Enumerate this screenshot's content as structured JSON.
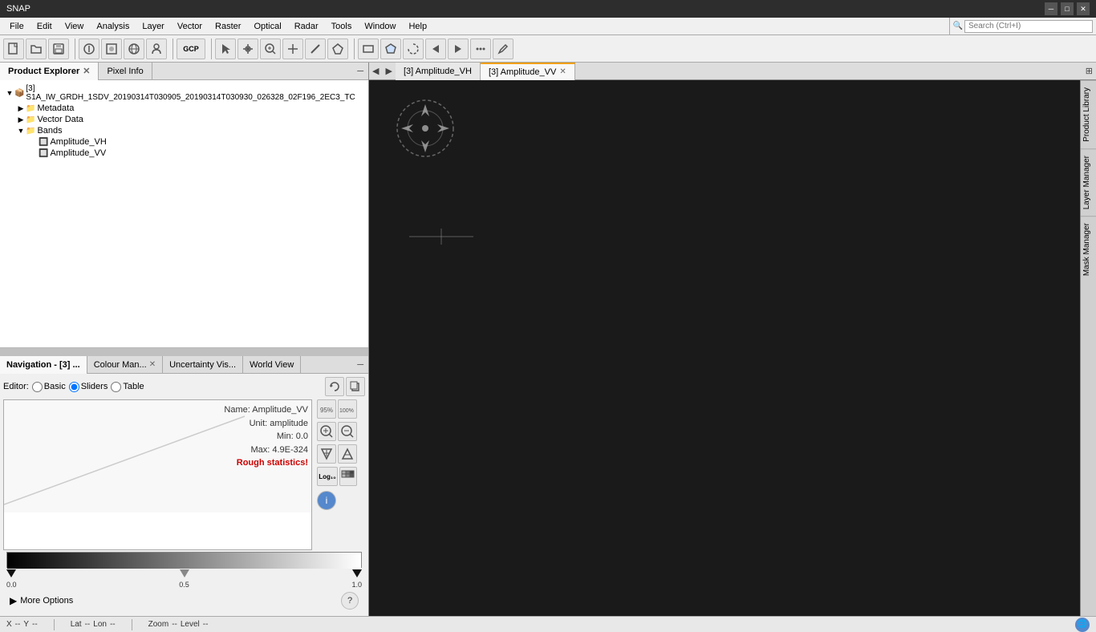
{
  "app": {
    "title": "SNAP",
    "window_controls": [
      "minimize",
      "maximize",
      "close"
    ]
  },
  "menubar": {
    "items": [
      "File",
      "Edit",
      "View",
      "Analysis",
      "Layer",
      "Vector",
      "Raster",
      "Optical",
      "Radar",
      "Tools",
      "Window",
      "Help"
    ]
  },
  "search": {
    "placeholder": "Search (Ctrl+I)",
    "value": ""
  },
  "toolbar": {
    "buttons": [
      {
        "name": "new",
        "icon": "⬜"
      },
      {
        "name": "open",
        "icon": "📁"
      },
      {
        "name": "save",
        "icon": "💾"
      },
      {
        "name": "print",
        "icon": "🖨"
      },
      {
        "name": "copy",
        "icon": "📋"
      },
      {
        "name": "paste",
        "icon": "📄"
      },
      {
        "name": "gcp",
        "icon": "GCP",
        "label": "GCP"
      },
      {
        "name": "select",
        "icon": "↖"
      },
      {
        "name": "pan",
        "icon": "✋"
      },
      {
        "name": "zoom",
        "icon": "🔍"
      },
      {
        "name": "pin",
        "icon": "+"
      },
      {
        "name": "draw-line",
        "icon": "╱"
      },
      {
        "name": "draw-poly",
        "icon": "⬟"
      },
      {
        "name": "draw-rect",
        "icon": "⬜"
      },
      {
        "name": "draw-ellipse",
        "icon": "⭕"
      },
      {
        "name": "warp",
        "icon": "↺"
      },
      {
        "name": "export",
        "icon": "➡"
      },
      {
        "name": "tool2",
        "icon": "↔"
      },
      {
        "name": "pencil",
        "icon": "✏"
      }
    ]
  },
  "left_panel": {
    "tabs": [
      {
        "label": "Product Explorer",
        "active": true,
        "closeable": true
      },
      {
        "label": "Pixel Info",
        "active": false,
        "closeable": false
      }
    ],
    "tree": {
      "root": {
        "label": "[3] S1A_IW_GRDH_1SDV_20190314T030905_20190314T030930_026328_02F196_2EC3_TC",
        "expanded": true,
        "children": [
          {
            "label": "Metadata",
            "icon": "folder",
            "expanded": false
          },
          {
            "label": "Vector Data",
            "icon": "folder",
            "expanded": false
          },
          {
            "label": "Bands",
            "icon": "folder",
            "expanded": true,
            "children": [
              {
                "label": "Amplitude_VH",
                "icon": "band"
              },
              {
                "label": "Amplitude_VV",
                "icon": "band"
              }
            ]
          }
        ]
      }
    }
  },
  "bottom_panel": {
    "tabs": [
      {
        "label": "Navigation - [3] ...",
        "active": true,
        "closeable": false
      },
      {
        "label": "Colour Man...",
        "active": false,
        "closeable": true
      },
      {
        "label": "Uncertainty Vis...",
        "active": false,
        "closeable": false
      },
      {
        "label": "World View",
        "active": false,
        "closeable": false
      }
    ],
    "colour_panel": {
      "editor_label": "Editor:",
      "options": [
        "Basic",
        "Sliders",
        "Table"
      ],
      "active_option": "Sliders",
      "band_info": {
        "name_label": "Name:",
        "name_value": "Amplitude_VV",
        "unit_label": "Unit:",
        "unit_value": "amplitude",
        "min_label": "Min:",
        "min_value": "0.0",
        "max_label": "Max:",
        "max_value": "4.9E-324",
        "warning": "Rough statistics!"
      },
      "gradient_labels": [
        "0.0",
        "0.5",
        "1.0"
      ],
      "side_buttons": [
        {
          "icon": "↩",
          "label": "reset"
        },
        {
          "icon": "⇄",
          "label": "flip"
        },
        {
          "icon": "95%",
          "label": "95pct"
        },
        {
          "icon": "100%",
          "label": "100pct"
        },
        {
          "icon": "🔍+",
          "label": "zoom-in-range"
        },
        {
          "icon": "🔍-",
          "label": "zoom-out-range"
        },
        {
          "icon": "📉",
          "label": "zoom-in"
        },
        {
          "icon": "📈",
          "label": "zoom-out"
        },
        {
          "icon": "Log₁₀",
          "label": "log10"
        },
        {
          "icon": "⋮⋮⋮",
          "label": "color-table"
        }
      ]
    },
    "more_options": {
      "label": "More Options",
      "help_icon": "?"
    }
  },
  "image_tabs": {
    "prev_nav": "◀",
    "next_nav": "▶",
    "expand": "⊞",
    "tabs": [
      {
        "label": "[3] Amplitude_VH",
        "active": false,
        "closeable": false
      },
      {
        "label": "[3] Amplitude_VV",
        "active": true,
        "closeable": true
      }
    ]
  },
  "right_side_tabs": [
    {
      "label": "Product Library"
    },
    {
      "label": "Layer Manager"
    },
    {
      "label": "Mask Manager"
    }
  ],
  "statusbar": {
    "x_label": "X",
    "x_value": "--",
    "y_label": "Y",
    "y_value": "--",
    "lat_label": "Lat",
    "lat_value": "--",
    "lon_label": "Lon",
    "lon_value": "--",
    "zoom_label": "Zoom",
    "zoom_value": "--",
    "level_label": "Level",
    "level_value": "--"
  }
}
